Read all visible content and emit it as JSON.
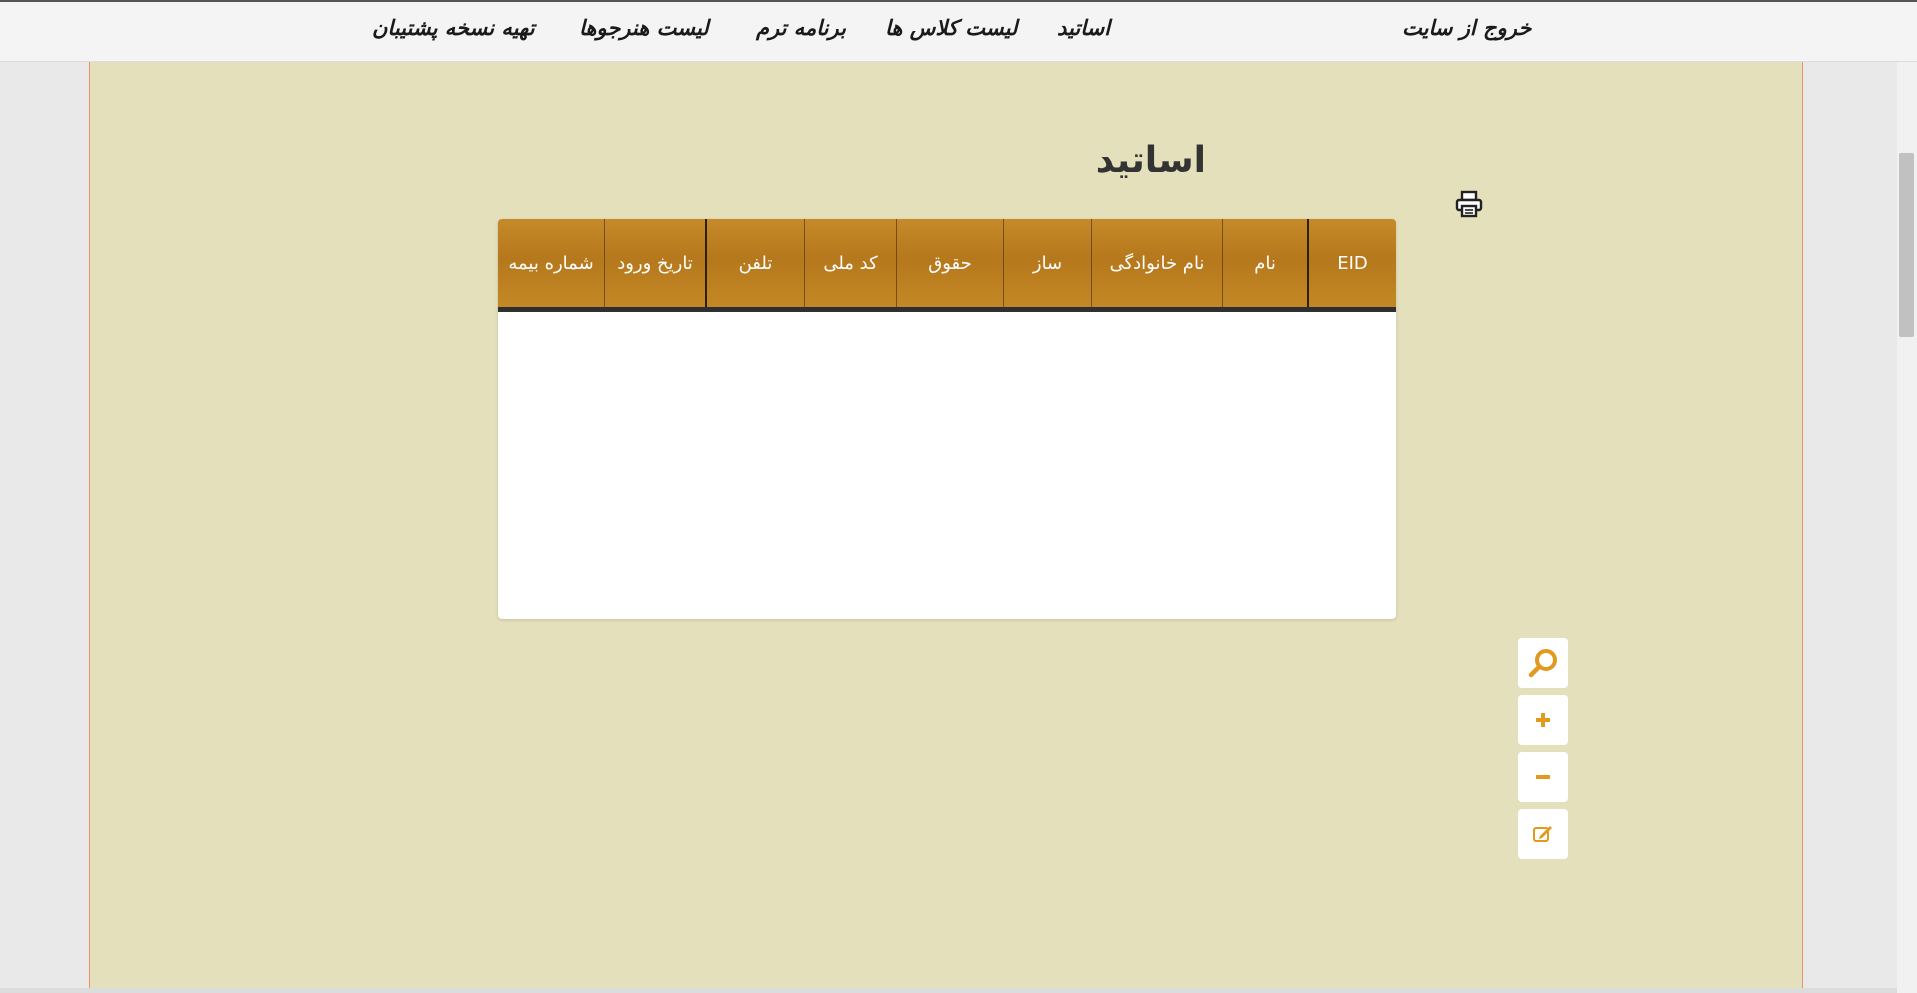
{
  "nav": {
    "logout": "خروج از سایت",
    "teachers": "اساتید",
    "class_list": "لیست کلاس ها",
    "term_schedule": "برنامه ترم",
    "student_list": "لیست هنرجوها",
    "backup": "تهیه نسخه پشتیبان"
  },
  "page": {
    "title": "اساتید"
  },
  "table": {
    "columns": [
      "EID",
      "نام",
      "نام خانوادگی",
      "ساز",
      "حقوق",
      "کد ملی",
      "تلفن",
      "تاریخ ورود",
      "شماره بیمه"
    ],
    "rows": []
  },
  "icons": {
    "print": "print-icon",
    "search": "search-icon",
    "add": "plus-icon",
    "remove": "minus-icon",
    "edit": "edit-icon"
  },
  "colors": {
    "content_bg": "#e4e0bb",
    "header_gold": "#b5781c",
    "accent": "#e19a1d"
  }
}
